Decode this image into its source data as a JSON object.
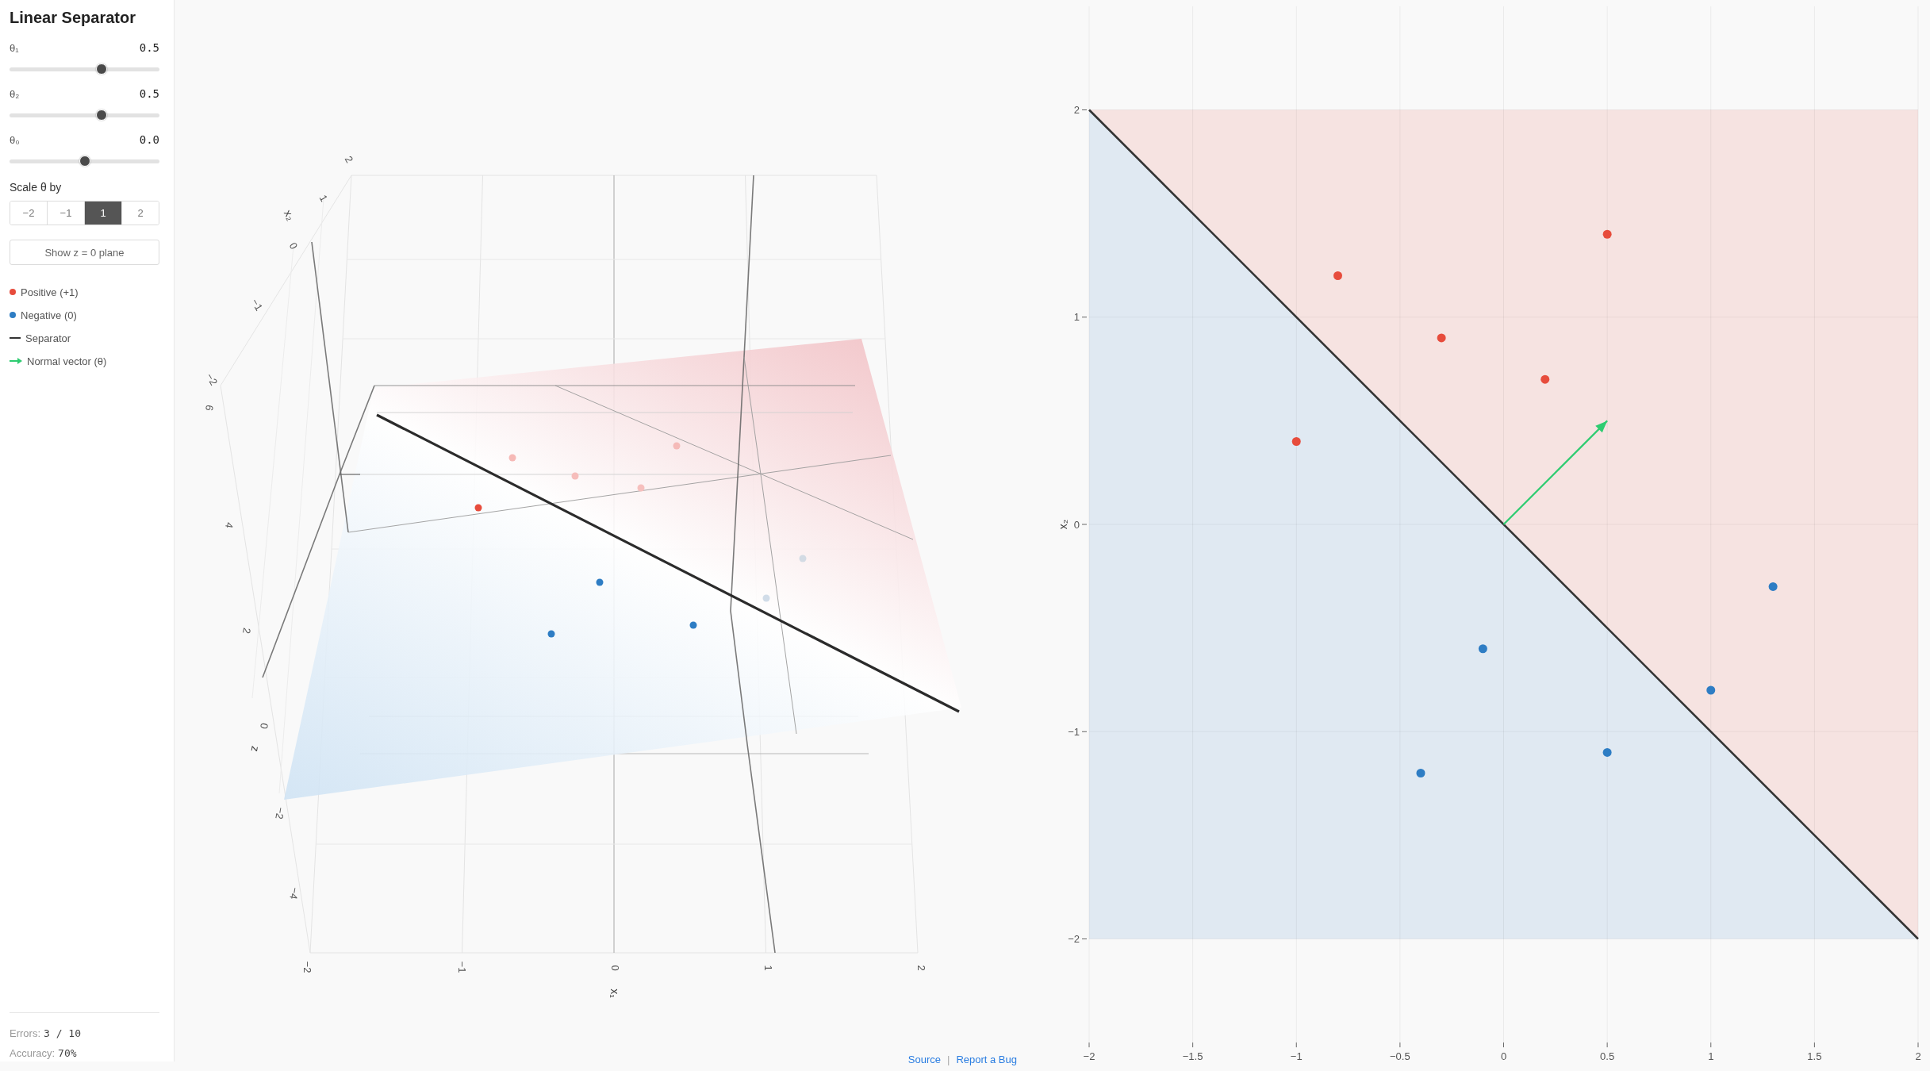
{
  "sidebar": {
    "title": "Linear Separator",
    "sliders": [
      {
        "label": "θ₁",
        "reading": "0.5",
        "level": 0.625
      },
      {
        "label": "θ₂",
        "reading": "0.5",
        "level": 0.625
      },
      {
        "label": "θ₀",
        "reading": "0.0",
        "level": 0.5
      }
    ],
    "scale": {
      "label": "Scale θ by",
      "options": [
        {
          "label": "−2",
          "selected": false
        },
        {
          "label": "−1",
          "selected": false
        },
        {
          "label": "1",
          "selected": true
        },
        {
          "label": "2",
          "selected": false
        }
      ]
    },
    "plane_button": "Show z = 0 plane",
    "legend": [
      {
        "kind": "dot",
        "label": "Positive (+1)",
        "color": "#e74c3c"
      },
      {
        "kind": "dot",
        "label": "Negative (0)",
        "color": "#2e7dc4"
      },
      {
        "kind": "line",
        "label": "Separator",
        "color": "#333333"
      },
      {
        "kind": "arrow",
        "label": "Normal vector (θ)",
        "color": "#2ecc71"
      }
    ],
    "stats": [
      {
        "label": "Errors:",
        "value": "3 / 10"
      },
      {
        "label": "Accuracy:",
        "value": "70%"
      }
    ]
  },
  "plot_3d": {
    "axes": [
      {
        "title": "x₁",
        "ticks": [
          "−2",
          "−1",
          "0",
          "1",
          "2"
        ]
      },
      {
        "title": "x₂",
        "ticks": [
          "2",
          "1",
          "0",
          "−1",
          "−2"
        ]
      },
      {
        "title": "z",
        "ticks": [
          "6",
          "4",
          "2",
          "0",
          "−2",
          "−4"
        ]
      }
    ]
  },
  "plot_2d": {
    "chart_data": {
      "type": "scatter",
      "ylabel": "x₂",
      "xlim": [
        -2,
        2
      ],
      "ylim": [
        -2.5,
        2.5
      ],
      "xticks": [
        {
          "value": -2,
          "label": "−2"
        },
        {
          "value": -1.5,
          "label": "−1.5"
        },
        {
          "value": -1,
          "label": "−1"
        },
        {
          "value": -0.5,
          "label": "−0.5"
        },
        {
          "value": 0,
          "label": "0"
        },
        {
          "value": 0.5,
          "label": "0.5"
        },
        {
          "value": 1,
          "label": "1"
        },
        {
          "value": 1.5,
          "label": "1.5"
        },
        {
          "value": 2,
          "label": "2"
        }
      ],
      "yticks": [
        {
          "value": 2,
          "label": "2"
        },
        {
          "value": 1,
          "label": "1"
        },
        {
          "value": 0,
          "label": "0"
        },
        {
          "value": -1,
          "label": "−1"
        },
        {
          "value": -2,
          "label": "−2"
        }
      ],
      "grid": true,
      "series": [
        {
          "color": "#e74c3c",
          "x": [
            -0.8,
            0.5,
            -0.3,
            0.2,
            -1.0
          ],
          "values": [
            1.2,
            1.4,
            0.9,
            0.7,
            0.4
          ]
        },
        {
          "color": "#2e7dc4",
          "x": [
            1.3,
            -0.1,
            1.0,
            0.5,
            -0.4
          ],
          "values": [
            -0.3,
            -0.6,
            -0.8,
            -1.1,
            -1.2
          ]
        },
        {
          "type": "line",
          "color": "#333333",
          "x": [
            -2,
            2
          ],
          "values": [
            2,
            -2
          ]
        },
        {
          "type": "line",
          "color": "#2ecc71",
          "x": [
            0,
            0.5
          ],
          "values": [
            0,
            0.5
          ]
        }
      ]
    }
  },
  "footer": {
    "links": [
      "Source",
      "Report a Bug"
    ],
    "separator": "|"
  }
}
